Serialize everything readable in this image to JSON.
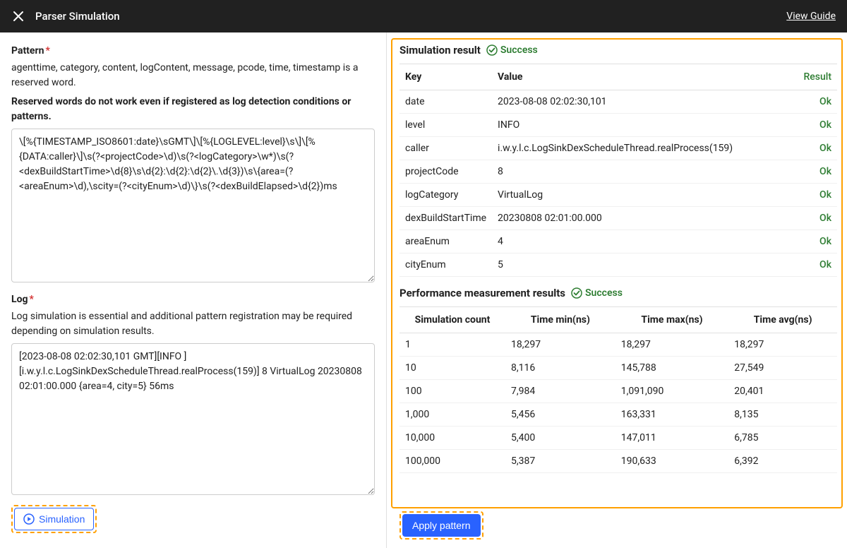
{
  "header": {
    "title": "Parser Simulation",
    "view_guide": "View Guide"
  },
  "left": {
    "pattern_label": "Pattern",
    "pattern_help1": "agenttime, category, content, logContent, message, pcode, time, timestamp is a reserved word.",
    "pattern_help2": "Reserved words do not work even if registered as log detection conditions or patterns.",
    "pattern_value": "\\[%{TIMESTAMP_ISO8601:date}\\sGMT\\]\\[%{LOGLEVEL:level}\\s\\]\\[%{DATA:caller}\\]\\s(?<projectCode>\\d)\\s(?<logCategory>\\w*)\\s(?<dexBuildStartTime>\\d{8}\\s\\d{2}:\\d{2}:\\d{2}\\.\\d{3})\\s\\{area=(?<areaEnum>\\d),\\scity=(?<cityEnum>\\d)\\}\\s(?<dexBuildElapsed>\\d{2})ms",
    "log_label": "Log",
    "log_help": "Log simulation is essential and additional pattern registration may be required depending on simulation results.",
    "log_value": "[2023-08-08 02:02:30,101 GMT][INFO ][i.w.y.l.c.LogSinkDexScheduleThread.realProcess(159)] 8 VirtualLog 20230808 02:01:00.000 {area=4, city=5} 56ms",
    "simulation_btn": "Simulation"
  },
  "right": {
    "sim_result_title": "Simulation result",
    "success_label": "Success",
    "table_headers": {
      "key": "Key",
      "value": "Value",
      "result": "Result"
    },
    "rows": [
      {
        "key": "date",
        "value": "2023-08-08 02:02:30,101",
        "result": "Ok"
      },
      {
        "key": "level",
        "value": "INFO",
        "result": "Ok"
      },
      {
        "key": "caller",
        "value": "i.w.y.l.c.LogSinkDexScheduleThread.realProcess(159)",
        "result": "Ok"
      },
      {
        "key": "projectCode",
        "value": "8",
        "result": "Ok"
      },
      {
        "key": "logCategory",
        "value": "VirtualLog",
        "result": "Ok"
      },
      {
        "key": "dexBuildStartTime",
        "value": "20230808 02:01:00.000",
        "result": "Ok"
      },
      {
        "key": "areaEnum",
        "value": "4",
        "result": "Ok"
      },
      {
        "key": "cityEnum",
        "value": "5",
        "result": "Ok"
      }
    ],
    "perf_title": "Performance measurement results",
    "perf_headers": {
      "count": "Simulation count",
      "min": "Time min(ns)",
      "max": "Time max(ns)",
      "avg": "Time avg(ns)"
    },
    "perf_rows": [
      {
        "count": "1",
        "min": "18,297",
        "max": "18,297",
        "avg": "18,297"
      },
      {
        "count": "10",
        "min": "8,116",
        "max": "145,788",
        "avg": "27,549"
      },
      {
        "count": "100",
        "min": "7,984",
        "max": "1,091,090",
        "avg": "20,401"
      },
      {
        "count": "1,000",
        "min": "5,456",
        "max": "163,331",
        "avg": "8,135"
      },
      {
        "count": "10,000",
        "min": "5,400",
        "max": "147,011",
        "avg": "6,785"
      },
      {
        "count": "100,000",
        "min": "5,387",
        "max": "190,633",
        "avg": "6,392"
      }
    ],
    "apply_btn": "Apply pattern"
  }
}
